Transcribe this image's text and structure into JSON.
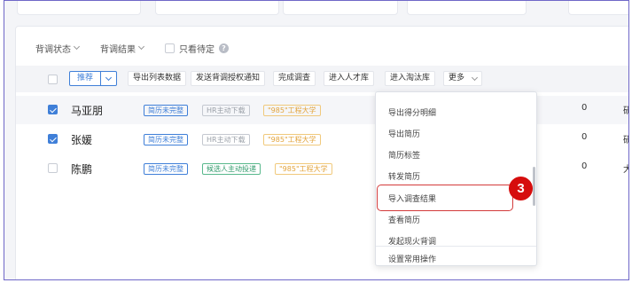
{
  "filters": {
    "status_label": "背调状态",
    "result_label": "背调结果",
    "only_pending_label": "只看待定",
    "help_icon_glyph": "?"
  },
  "toolbar": {
    "recommend_label": "推荐",
    "buttons": [
      "导出列表数据",
      "发送背调授权通知",
      "完成调查",
      "进入人才库",
      "进入淘汰库"
    ],
    "more_label": "更多"
  },
  "rows": [
    {
      "name": "马亚朋",
      "checked": true,
      "tags": [
        "简历未完整",
        "HR主动下载",
        "\"985\"工程大学"
      ],
      "count": "0",
      "trail": "研"
    },
    {
      "name": "张媛",
      "checked": true,
      "tags": [
        "简历未完整",
        "HR主动下载",
        "\"985\"工程大学"
      ],
      "count": "0",
      "trail": "研"
    },
    {
      "name": "陈鹏",
      "checked": false,
      "tags": [
        "简历未完整",
        "候选人主动投递",
        "\"985\"工程大学"
      ],
      "count": "0",
      "trail": "大"
    }
  ],
  "menu": {
    "items": [
      "导出得分明细",
      "导出简历",
      "简历标签",
      "转发简历",
      "导入调查结果",
      "查看简历",
      "发起现火背调"
    ],
    "footer": "设置常用操作",
    "highlighted_item": "导入调查结果"
  },
  "annotation": {
    "step_number": "3",
    "color": "#d60d0d"
  }
}
